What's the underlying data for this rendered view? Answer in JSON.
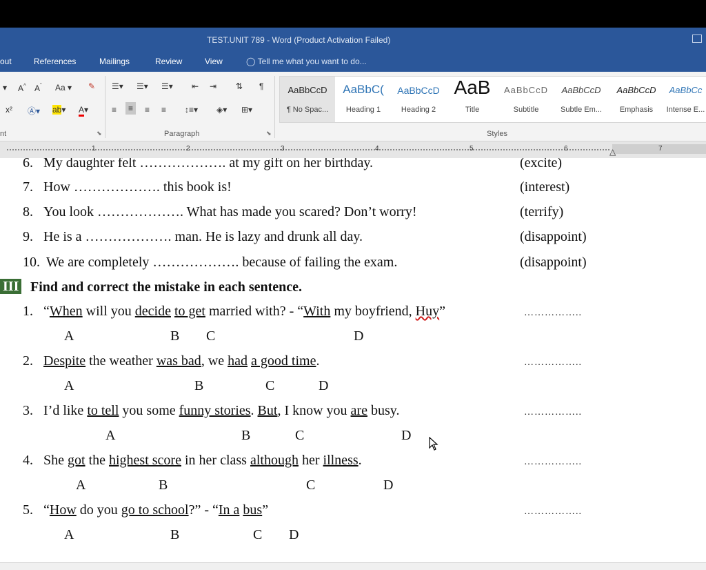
{
  "window": {
    "title": "TEST.UNIT 789 - Word (Product Activation Failed)"
  },
  "menu": {
    "items": [
      "out",
      "References",
      "Mailings",
      "Review",
      "View"
    ],
    "tell_me": "Tell me what you want to do..."
  },
  "ribbon": {
    "font_left": "nt",
    "paragraph_label": "Paragraph",
    "styles_label": "Styles",
    "styles": [
      {
        "sample": "AaBbCcD",
        "name": "¶ No Spac..."
      },
      {
        "sample": "AaBbC(",
        "name": "Heading 1"
      },
      {
        "sample": "AaBbCcD",
        "name": "Heading 2"
      },
      {
        "sample": "AaB",
        "name": "Title"
      },
      {
        "sample": "AaBbCcD",
        "name": "Subtitle"
      },
      {
        "sample": "AaBbCcD",
        "name": "Subtle Em..."
      },
      {
        "sample": "AaBbCcD",
        "name": "Emphasis"
      },
      {
        "sample": "AaBbCc",
        "name": "Intense E..."
      }
    ]
  },
  "ruler": {
    "numbers": [
      "1",
      "2",
      "3",
      "4",
      "5",
      "6",
      "7"
    ]
  },
  "part2": [
    {
      "num": "6.",
      "text": "My daughter felt ………………. at my gift on her birthday.",
      "hint": "(excite)"
    },
    {
      "num": "7.",
      "text": "How ………………. this book is!",
      "hint": "(interest)"
    },
    {
      "num": "8.",
      "text": "You look ………………. What has made you scared? Don’t worry!",
      "hint": "(terrify)"
    },
    {
      "num": "9.",
      "text": "He is a ………………. man. He is lazy and drunk all day.",
      "hint": "(disappoint)"
    },
    {
      "num": "10.",
      "text": "We are completely ………………. because of failing the exam.",
      "hint": "(disappoint)"
    }
  ],
  "section": {
    "badge": "III",
    "title": "Find and correct the mistake in each sentence."
  },
  "answer_blank": "……………..",
  "questions": [
    {
      "num": "1.",
      "parts": [
        "“",
        "When",
        " will you ",
        "decide",
        " ",
        "to get",
        " married with? - “",
        "With",
        " my boyfriend, ",
        "Huy",
        "”"
      ],
      "options": [
        "A",
        "B",
        "C",
        "D"
      ]
    },
    {
      "num": "2.",
      "parts": [
        "Despite",
        " the weather ",
        "was bad",
        ", we ",
        "had",
        " ",
        "a good time",
        "."
      ],
      "options": [
        "A",
        "B",
        "C",
        "D"
      ]
    },
    {
      "num": "3.",
      "parts": [
        "I’d like ",
        "to tell",
        " you some ",
        "funny stories",
        ". ",
        "But",
        ", I know you ",
        "are",
        " busy."
      ],
      "options": [
        "A",
        "B",
        "C",
        "D"
      ]
    },
    {
      "num": "4.",
      "parts": [
        "She ",
        "got",
        " the ",
        "highest score",
        " in her class ",
        "although",
        " her ",
        "illness",
        "."
      ],
      "options": [
        "A",
        "B",
        "C",
        "D"
      ]
    },
    {
      "num": "5.",
      "parts": [
        "“",
        "How",
        " do you ",
        "go to school",
        "?” - “",
        "In a",
        " ",
        "bus",
        "”"
      ],
      "options": [
        "A",
        "B",
        "C",
        "D"
      ]
    }
  ]
}
